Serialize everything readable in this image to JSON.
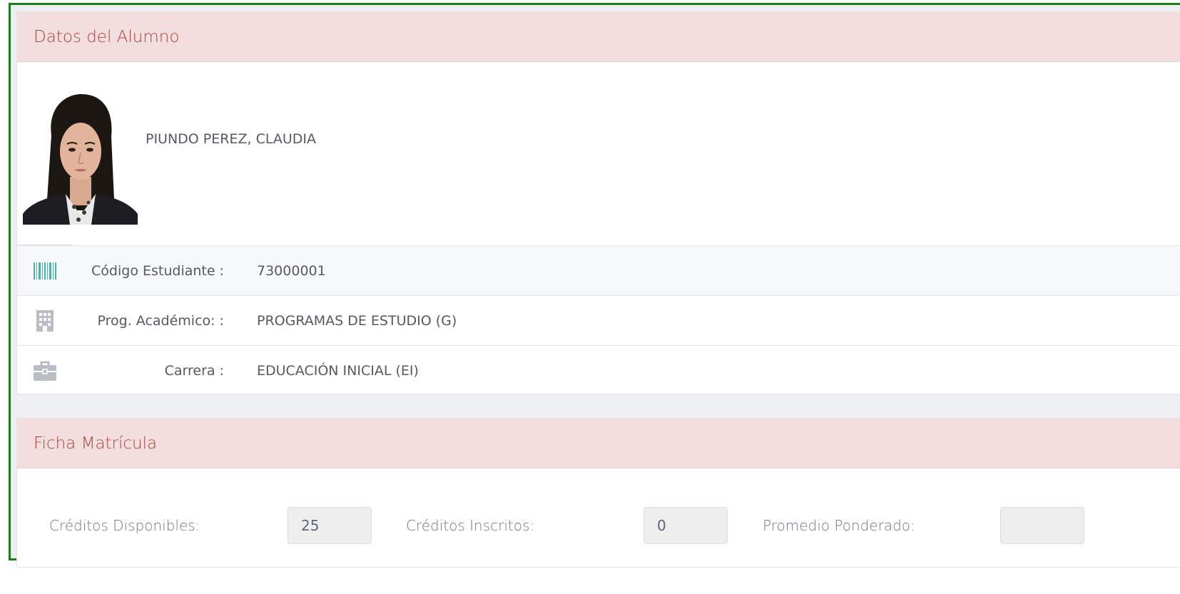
{
  "alumno_panel": {
    "heading": "Datos del Alumno",
    "student_name": "PIUNDO PEREZ, CLAUDIA",
    "rows": [
      {
        "icon": "barcode-icon",
        "label": "Código Estudiante :",
        "value": "73000001"
      },
      {
        "icon": "building-icon",
        "label": "Prog. Académico: :",
        "value": "PROGRAMAS DE ESTUDIO (G)"
      },
      {
        "icon": "briefcase-icon",
        "label": "Carrera :",
        "value": "EDUCACIÓN INICIAL (EI)"
      }
    ]
  },
  "ficha_panel": {
    "heading": "Ficha Matrícula",
    "fields": [
      {
        "label": "Créditos Disponibles:",
        "value": "25"
      },
      {
        "label": "Créditos Inscritos:",
        "value": "0"
      },
      {
        "label": "Promedio Ponderado:",
        "value": ""
      }
    ]
  },
  "colors": {
    "frame_border": "#1e7d1e",
    "heading_bg": "#f2dede",
    "heading_text": "#a94442",
    "icon_teal": "#4ab3a8",
    "icon_gray": "#b9bec6"
  }
}
